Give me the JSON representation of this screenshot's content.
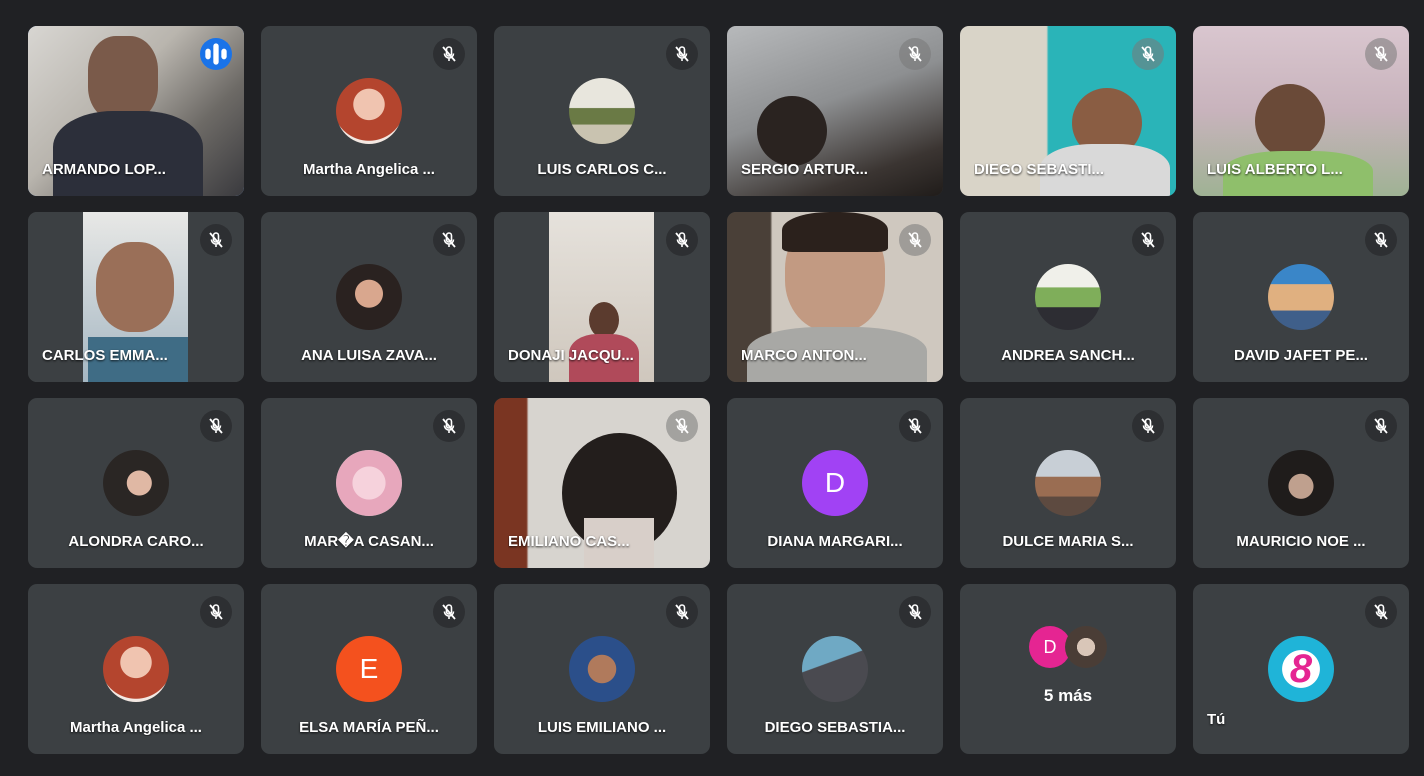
{
  "participants": [
    {
      "name": "ARMANDO LOP...",
      "kind": "video",
      "speaking": true
    },
    {
      "name": "Martha Angelica ...",
      "kind": "photo"
    },
    {
      "name": "LUIS CARLOS C...",
      "kind": "photo"
    },
    {
      "name": "SERGIO ARTUR...",
      "kind": "video"
    },
    {
      "name": "DIEGO SEBASTI...",
      "kind": "video"
    },
    {
      "name": "LUIS ALBERTO L...",
      "kind": "video"
    },
    {
      "name": "CARLOS EMMA...",
      "kind": "video"
    },
    {
      "name": "ANA LUISA ZAVA...",
      "kind": "photo"
    },
    {
      "name": "DONAJI JACQU...",
      "kind": "video"
    },
    {
      "name": "MARCO ANTON...",
      "kind": "video"
    },
    {
      "name": "ANDREA SANCH...",
      "kind": "photo"
    },
    {
      "name": "DAVID JAFET PE...",
      "kind": "photo"
    },
    {
      "name": "ALONDRA CARO...",
      "kind": "photo"
    },
    {
      "name": "MAR�A CASAN...",
      "kind": "photo"
    },
    {
      "name": "EMILIANO CAS...",
      "kind": "video"
    },
    {
      "name": "DIANA MARGARI...",
      "kind": "letter",
      "letter": "D",
      "color": "#a142f4"
    },
    {
      "name": "DULCE MARIA S...",
      "kind": "photo"
    },
    {
      "name": "MAURICIO NOE ...",
      "kind": "photo"
    },
    {
      "name": "Martha Angelica ...",
      "kind": "photo"
    },
    {
      "name": "ELSA MARÍA PEÑ...",
      "kind": "letter",
      "letter": "E",
      "color": "#f4511e"
    },
    {
      "name": "LUIS EMILIANO ...",
      "kind": "photo"
    },
    {
      "name": "DIEGO SEBASTIA...",
      "kind": "photo"
    }
  ],
  "more_tile": {
    "label": "5 más",
    "letter": "D",
    "letter_color": "#e52592"
  },
  "self_tile": {
    "name": "Tú",
    "logo_text": "8"
  },
  "colors": {
    "tile": "#3c4043",
    "background": "#202124",
    "accent": "#1a73e8"
  }
}
